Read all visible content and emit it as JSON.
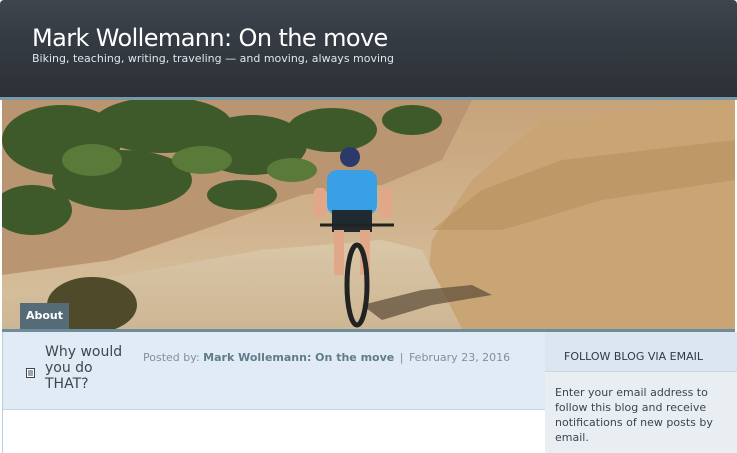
{
  "site": {
    "title": "Mark Wollemann: On the move",
    "tagline": "Biking, teaching, writing, traveling — and moving, always moving"
  },
  "nav": {
    "items": [
      {
        "label": "About"
      }
    ]
  },
  "post": {
    "title": "Why would you do THAT?",
    "meta_prefix": "Posted by:",
    "author": "Mark Wollemann: On the move",
    "separator": "|",
    "date": "February 23, 2016",
    "icon": "document-icon"
  },
  "sidebar": {
    "widget_title": "FOLLOW BLOG VIA EMAIL",
    "widget_text": "Enter your email address to follow this blog and receive notifications of new posts by email."
  },
  "colors": {
    "header_bg": "#353b42",
    "accent": "#6e8c9b",
    "post_head_bg": "#e1ebf5",
    "sidebar_bg": "#e9eef3"
  }
}
